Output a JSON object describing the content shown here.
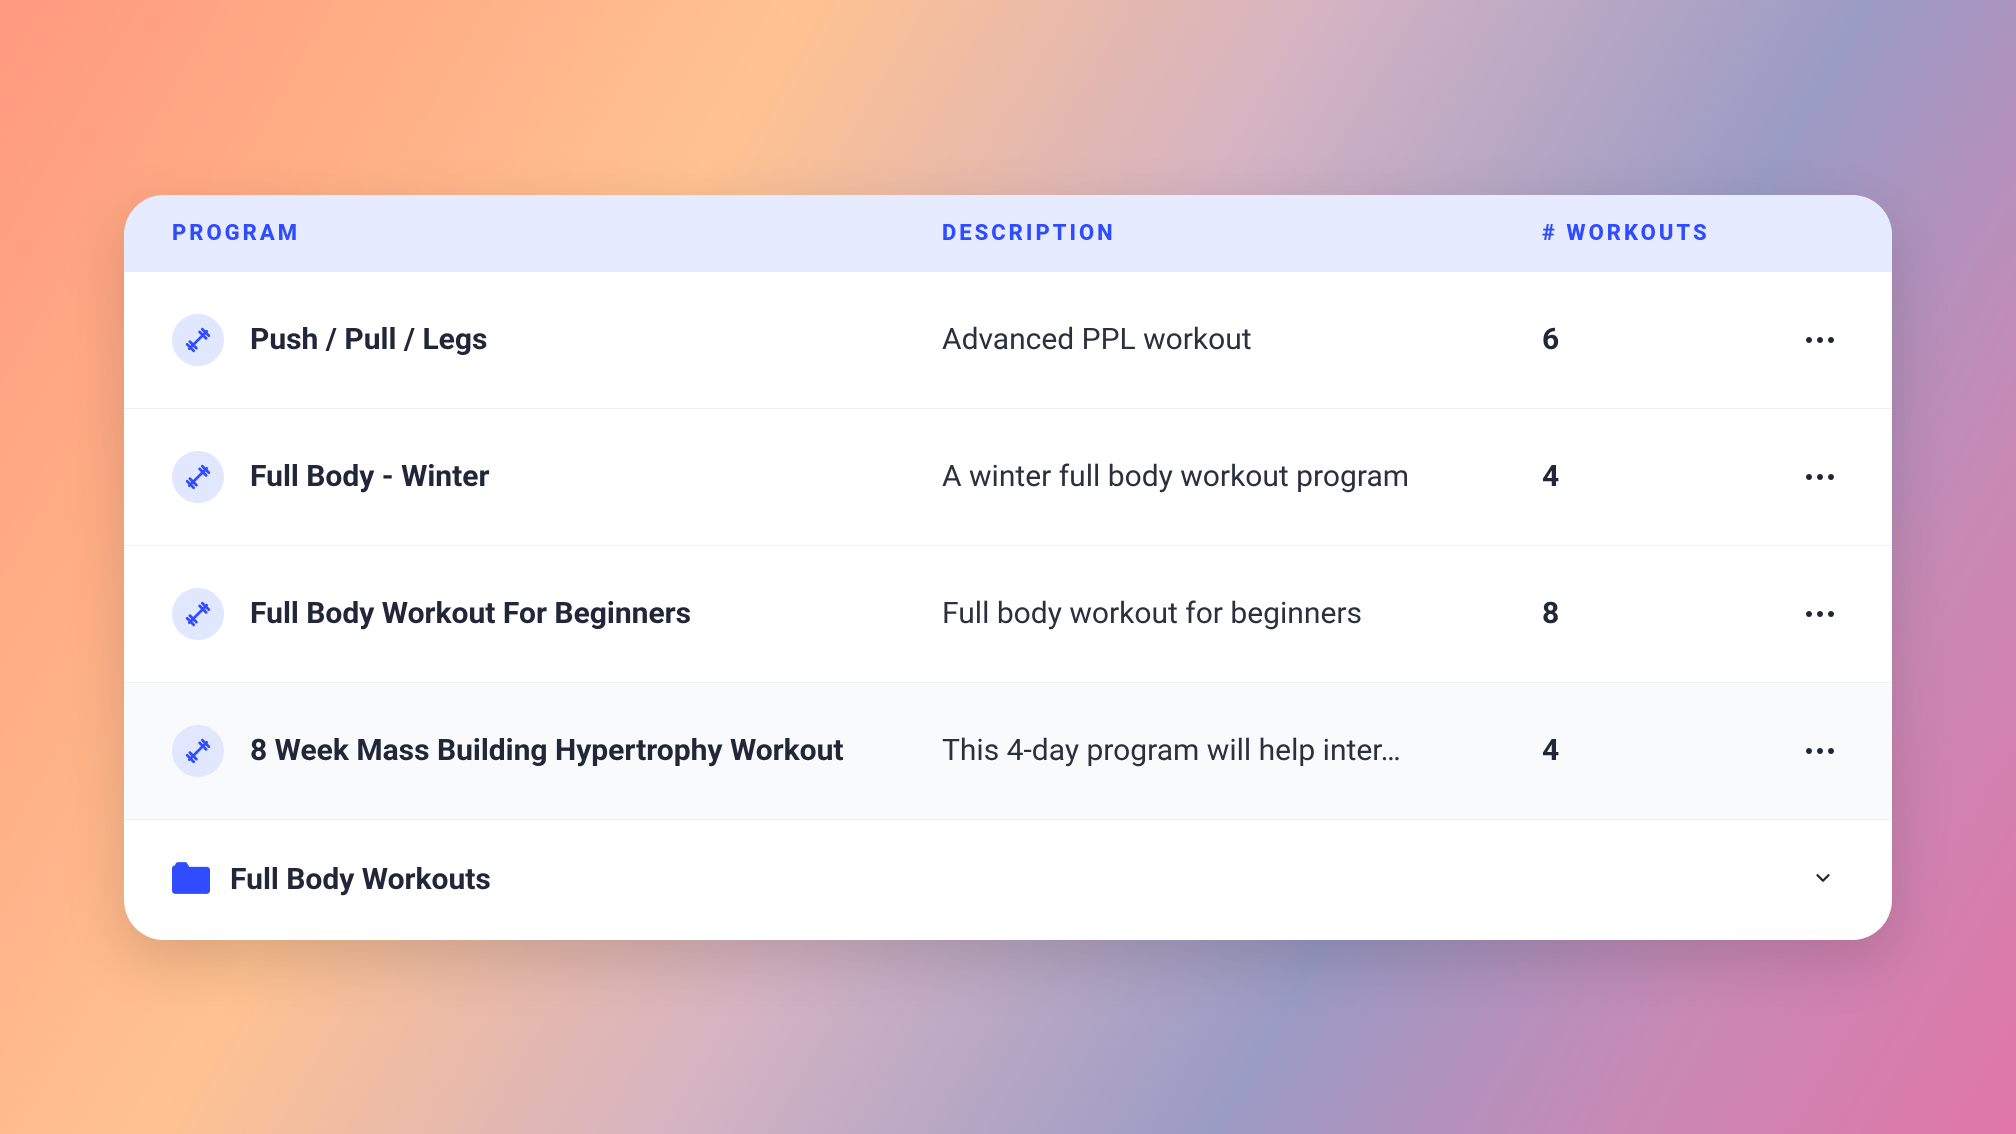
{
  "columns": {
    "program": "Program",
    "description": "Description",
    "workouts": "# Workouts"
  },
  "rows": [
    {
      "name": "Push / Pull / Legs",
      "description": "Advanced PPL workout",
      "workouts": "6",
      "selected": false
    },
    {
      "name": "Full Body - Winter",
      "description": "A winter full body workout program",
      "workouts": "4",
      "selected": false
    },
    {
      "name": "Full Body Workout For Beginners",
      "description": "Full body workout for beginners",
      "workouts": "8",
      "selected": false
    },
    {
      "name": "8 Week Mass Building Hypertrophy Workout",
      "description": "This 4-day program will help inter…",
      "workouts": "4",
      "selected": true
    }
  ],
  "folder": {
    "name": "Full Body Workouts"
  }
}
